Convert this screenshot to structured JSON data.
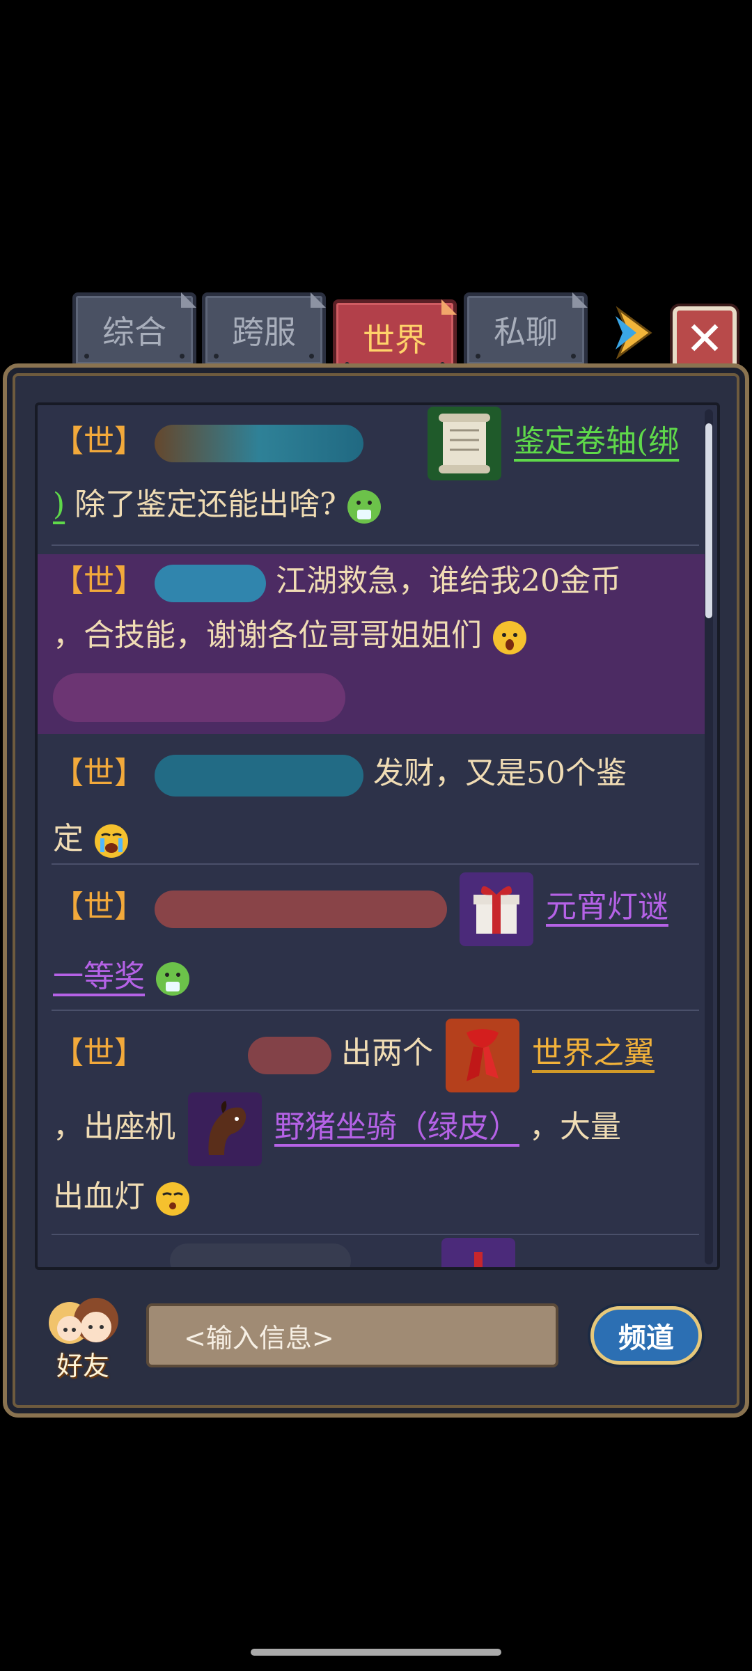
{
  "tabs": [
    {
      "label": "综合",
      "active": false
    },
    {
      "label": "跨服",
      "active": false
    },
    {
      "label": "世界",
      "active": true
    },
    {
      "label": "私聊",
      "active": false
    }
  ],
  "messages": [
    {
      "tag": "【世】",
      "item": "鉴定卷轴(绑",
      "item_cont": ")",
      "text": "除了鉴定还能出啥?"
    },
    {
      "tag": "【世】",
      "line1": "江湖救急，谁给我20金币",
      "line2": "，合技能，谢谢各位哥哥姐姐们"
    },
    {
      "tag": "【世】",
      "line1": "发财，又是50个鉴",
      "line2": "定"
    },
    {
      "tag": "【世】",
      "item": "元宵灯谜",
      "item_cont": "一等奖"
    },
    {
      "tag": "【世】",
      "text1": "出两个",
      "item1": "世界之翼",
      "text2": "，出座机",
      "item2": "野猪坐骑（绿皮）",
      "text3": "，大量",
      "text4": "出血灯"
    }
  ],
  "input": {
    "placeholder": "<输入信息>"
  },
  "buttons": {
    "friends": "好友",
    "channel": "频道",
    "close": "✕"
  },
  "colors": {
    "active_tab": "#b2404a",
    "tag": "#f2a93b",
    "green_item": "#5fd94a",
    "purple_item": "#b562e6",
    "gold_item": "#f2b23a"
  }
}
